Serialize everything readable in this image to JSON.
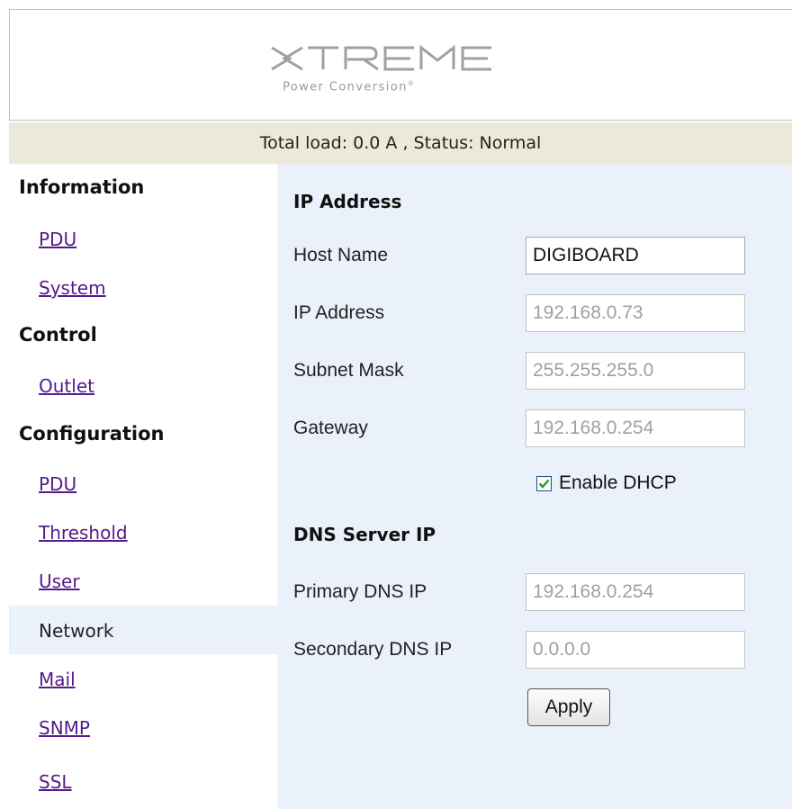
{
  "logo": {
    "name": "XTREME",
    "tagline": "Power Conversion",
    "trademark": "®",
    "color": "#9a9a9a"
  },
  "status": {
    "text": "Total load: 0.0 A , Status: Normal"
  },
  "sidebar": {
    "sections": [
      {
        "heading": "Information",
        "items": [
          "PDU",
          "System"
        ]
      },
      {
        "heading": "Control",
        "items": [
          "Outlet"
        ]
      },
      {
        "heading": "Configuration",
        "items": [
          "PDU",
          "Threshold",
          "User",
          "Network",
          "Mail",
          "SNMP",
          "SSL"
        ]
      }
    ],
    "active_item": "Network"
  },
  "form": {
    "ip_section_title": "IP Address",
    "host_name": {
      "label": "Host Name",
      "value": "DIGIBOARD"
    },
    "ip_address": {
      "label": "IP Address",
      "value": "192.168.0.73"
    },
    "subnet_mask": {
      "label": "Subnet Mask",
      "value": "255.255.255.0"
    },
    "gateway": {
      "label": "Gateway",
      "value": "192.168.0.254"
    },
    "dhcp": {
      "label": "Enable DHCP",
      "checked": true
    },
    "dns_section_title": "DNS Server IP",
    "primary_dns": {
      "label": "Primary DNS IP",
      "value": "192.168.0.254"
    },
    "secondary_dns": {
      "label": "Secondary DNS IP",
      "value": "0.0.0.0"
    },
    "apply_label": "Apply"
  },
  "colors": {
    "status_bar": "#ece9d8",
    "content_bg": "#ebf1fb",
    "link": "#551a8b",
    "checkmark": "#21a121"
  }
}
